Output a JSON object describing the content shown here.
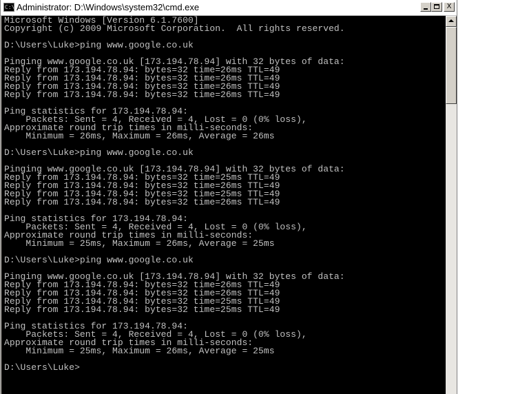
{
  "window": {
    "title": "Administrator: D:\\Windows\\system32\\cmd.exe",
    "icon": "C:\\",
    "controls": {
      "minimize_icon": "minimize-icon",
      "maximize_icon": "maximize-icon",
      "close_label": "X"
    }
  },
  "console": {
    "background": "#000000",
    "foreground": "#c0c0c0",
    "lines": [
      "Microsoft Windows [Version 6.1.7600]",
      "Copyright (c) 2009 Microsoft Corporation.  All rights reserved.",
      "",
      "D:\\Users\\Luke>ping www.google.co.uk",
      "",
      "Pinging www.google.co.uk [173.194.78.94] with 32 bytes of data:",
      "Reply from 173.194.78.94: bytes=32 time=26ms TTL=49",
      "Reply from 173.194.78.94: bytes=32 time=26ms TTL=49",
      "Reply from 173.194.78.94: bytes=32 time=26ms TTL=49",
      "Reply from 173.194.78.94: bytes=32 time=26ms TTL=49",
      "",
      "Ping statistics for 173.194.78.94:",
      "    Packets: Sent = 4, Received = 4, Lost = 0 (0% loss),",
      "Approximate round trip times in milli-seconds:",
      "    Minimum = 26ms, Maximum = 26ms, Average = 26ms",
      "",
      "D:\\Users\\Luke>ping www.google.co.uk",
      "",
      "Pinging www.google.co.uk [173.194.78.94] with 32 bytes of data:",
      "Reply from 173.194.78.94: bytes=32 time=25ms TTL=49",
      "Reply from 173.194.78.94: bytes=32 time=26ms TTL=49",
      "Reply from 173.194.78.94: bytes=32 time=25ms TTL=49",
      "Reply from 173.194.78.94: bytes=32 time=26ms TTL=49",
      "",
      "Ping statistics for 173.194.78.94:",
      "    Packets: Sent = 4, Received = 4, Lost = 0 (0% loss),",
      "Approximate round trip times in milli-seconds:",
      "    Minimum = 25ms, Maximum = 26ms, Average = 25ms",
      "",
      "D:\\Users\\Luke>ping www.google.co.uk",
      "",
      "Pinging www.google.co.uk [173.194.78.94] with 32 bytes of data:",
      "Reply from 173.194.78.94: bytes=32 time=26ms TTL=49",
      "Reply from 173.194.78.94: bytes=32 time=26ms TTL=49",
      "Reply from 173.194.78.94: bytes=32 time=25ms TTL=49",
      "Reply from 173.194.78.94: bytes=32 time=25ms TTL=49",
      "",
      "Ping statistics for 173.194.78.94:",
      "    Packets: Sent = 4, Received = 4, Lost = 0 (0% loss),",
      "Approximate round trip times in milli-seconds:",
      "    Minimum = 25ms, Maximum = 26ms, Average = 25ms",
      "",
      "D:\\Users\\Luke>"
    ]
  },
  "scrollbar": {
    "up_icon": "scroll-up-arrow-icon"
  }
}
